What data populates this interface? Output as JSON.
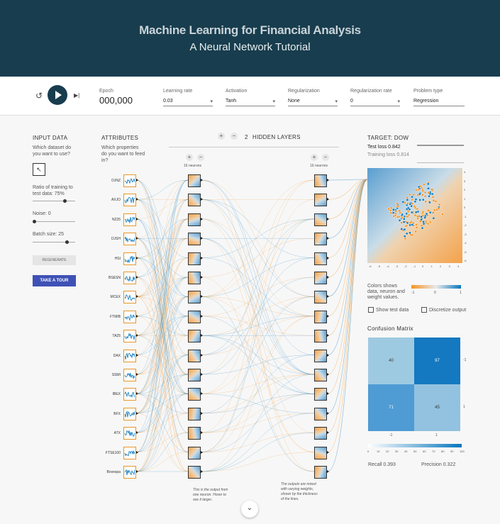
{
  "header": {
    "title": "Machine Learning for Financial Analysis",
    "subtitle": "A Neural Network Tutorial"
  },
  "controls": {
    "reset_icon": "reset-icon",
    "play_icon": "play-icon",
    "step_icon": "step-icon",
    "epoch_label": "Epoch",
    "epoch_value": "000,000",
    "learning_rate_label": "Learning rate",
    "learning_rate_value": "0.03",
    "activation_label": "Activation",
    "activation_value": "Tanh",
    "regularization_label": "Regularization",
    "regularization_value": "None",
    "reg_rate_label": "Regularization rate",
    "reg_rate_value": "0",
    "problem_type_label": "Problem type",
    "problem_type_value": "Regression"
  },
  "input_data": {
    "title": "INPUT DATA",
    "subtitle": "Which dataset do you want to use?",
    "ratio_label": "Ratio of training to test data:",
    "ratio_value": "75%",
    "ratio_fraction": 0.75,
    "noise_label": "Noise:",
    "noise_value": "0",
    "noise_fraction": 0.0,
    "batch_label": "Batch size:",
    "batch_value": "25",
    "batch_fraction": 0.8,
    "regenerate_label": "REGENERATE",
    "tour_label": "TAKE A TOUR"
  },
  "attributes": {
    "title": "ATTRIBUTES",
    "subtitle": "Which properties do you want to feed in?",
    "features": [
      "DJNZ",
      "AXJO",
      "N225",
      "DJSH",
      "HSI",
      "BSESN",
      "MCEX",
      "FTMIB",
      "TA25",
      "DAX",
      "SSMI",
      "IBEX",
      "BFX",
      "ATX",
      "FTSE100",
      "Bovespa"
    ]
  },
  "layers": {
    "count": "2",
    "label": "HIDDEN LAYERS",
    "layer1_label": "16 neurons",
    "layer2_label": "16 neurons",
    "note1": "This is the output from one neuron. Hover to see it larger.",
    "note2": "The outputs are mixed with varying weights, shown by the thickness of the lines."
  },
  "output": {
    "title": "TARGET: DOW",
    "test_loss": "Test loss 0.842",
    "training_loss": "Training loss 0.814",
    "axis_ticks": [
      "-6",
      "-5",
      "-4",
      "-3",
      "-2",
      "-1",
      "0",
      "1",
      "2",
      "3",
      "4"
    ],
    "legend_text": "Colors shows data, neuron and weight values.",
    "legend_ticks": [
      "-1",
      "0",
      "1"
    ],
    "show_test_label": "Show test data",
    "discretize_label": "Discretize output"
  },
  "confusion": {
    "title": "Confusion Matrix",
    "cells": [
      "40",
      "97",
      "71",
      "45"
    ],
    "x_ticks": [
      "-1",
      "1"
    ],
    "y_ticks": [
      "-1",
      "1"
    ],
    "scale_ticks": [
      "0",
      "10",
      "20",
      "30",
      "40",
      "50",
      "60",
      "70",
      "80",
      "90",
      "100"
    ],
    "recall": "Recall 0.393",
    "precision": "Precision 0.322"
  },
  "colors": {
    "orange": "#f59322",
    "blue": "#0877bd",
    "header": "#183d4e",
    "button_blue": "#3f51b5"
  }
}
